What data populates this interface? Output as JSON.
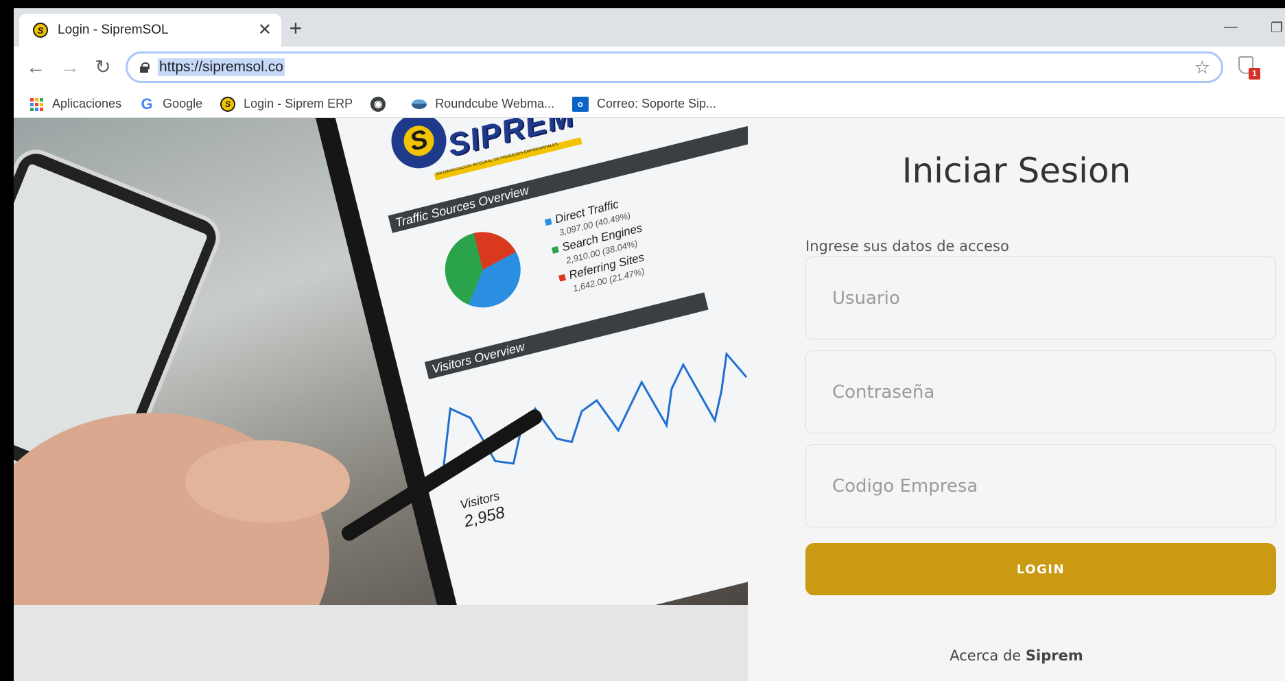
{
  "browser": {
    "tab": {
      "title": "Login - SipremSOL",
      "close_icon": "close-icon"
    },
    "new_tab_icon": "plus-icon",
    "address": {
      "url": "https://sipremsol.co"
    },
    "extension_badge": "1"
  },
  "bookmarks": [
    {
      "label": "Aplicaciones",
      "icon": "apps-grid-icon"
    },
    {
      "label": "Google",
      "icon": "google-icon"
    },
    {
      "label": "Login - Siprem ERP",
      "icon": "siprem-icon"
    },
    {
      "label": "",
      "icon": "globe-icon"
    },
    {
      "label": "Roundcube Webma...",
      "icon": "roundcube-icon"
    },
    {
      "label": "Correo: Soporte Sip...",
      "icon": "outlook-icon"
    }
  ],
  "hero": {
    "logo_text": "SIPREM",
    "logo_tagline": "SISTEMATIZACIÓN INTEGRAL DE PROCESOS EMPRESARIALES",
    "panel_traffic": "Traffic Sources Overview",
    "panel_visitors": "Visitors Overview",
    "legend": [
      {
        "label": "Direct Traffic",
        "value": "3,097.00 (40.49%)",
        "color": "#2a8fe0"
      },
      {
        "label": "Search Engines",
        "value": "2,910.00 (38.04%)",
        "color": "#2aa34a"
      },
      {
        "label": "Referring Sites",
        "value": "1,642.00 (21.47%)",
        "color": "#d93a1e"
      }
    ],
    "visitors_label": "Visitors",
    "visitors_value": "2,958"
  },
  "login": {
    "title": "Iniciar Sesion",
    "subtitle": "Ingrese sus datos de acceso",
    "user_placeholder": "Usuario",
    "password_placeholder": "Contraseña",
    "company_placeholder": "Codigo Empresa",
    "button": "LOGIN",
    "about_prefix": "Acerca de ",
    "about_brand": "Siprem"
  },
  "colors": {
    "login_button": "#c99a12",
    "omnibox_focus": "#a8c7fa",
    "tabstrip": "#dee1e6"
  }
}
